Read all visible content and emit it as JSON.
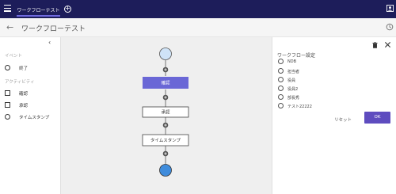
{
  "topbar": {
    "tab_label": "ワークフローテスト",
    "menu_icon": "hamburger-icon",
    "add_icon": "add-circle-icon",
    "account_icon": "account-square-icon",
    "bg_color": "#1d1d5a"
  },
  "subheader": {
    "title": "ワークフローテスト",
    "back_icon": "back-arrow-icon",
    "settings_icon": "settings-icon"
  },
  "left_panel": {
    "collapse_icon": "chevron-left-icon",
    "events_label": "イベント",
    "events": [
      {
        "label": "終了",
        "shape": "circle"
      }
    ],
    "activities_label": "アクティビティ",
    "activities": [
      {
        "label": "確認",
        "shape": "square"
      },
      {
        "label": "承認",
        "shape": "square"
      },
      {
        "label": "タイムスタンプ",
        "shape": "circle"
      }
    ]
  },
  "canvas": {
    "nodes": [
      {
        "label": "確認",
        "selected": true
      },
      {
        "label": "承認",
        "selected": false
      },
      {
        "label": "タイムスタンプ",
        "selected": false
      }
    ],
    "accent_color": "#6a67d6",
    "end_color": "#3f8cdc",
    "start_color": "#cfe3f7"
  },
  "right_panel": {
    "title": "ワークフロー設定",
    "options": [
      {
        "label": "NDB"
      },
      {
        "label": "担当者"
      },
      {
        "label": "役員"
      },
      {
        "label": "役員2"
      },
      {
        "label": "部長秀"
      },
      {
        "label": "テスト22222"
      }
    ],
    "reset_label": "リセット",
    "ok_label": "OK",
    "ok_color": "#5e4cbf"
  }
}
